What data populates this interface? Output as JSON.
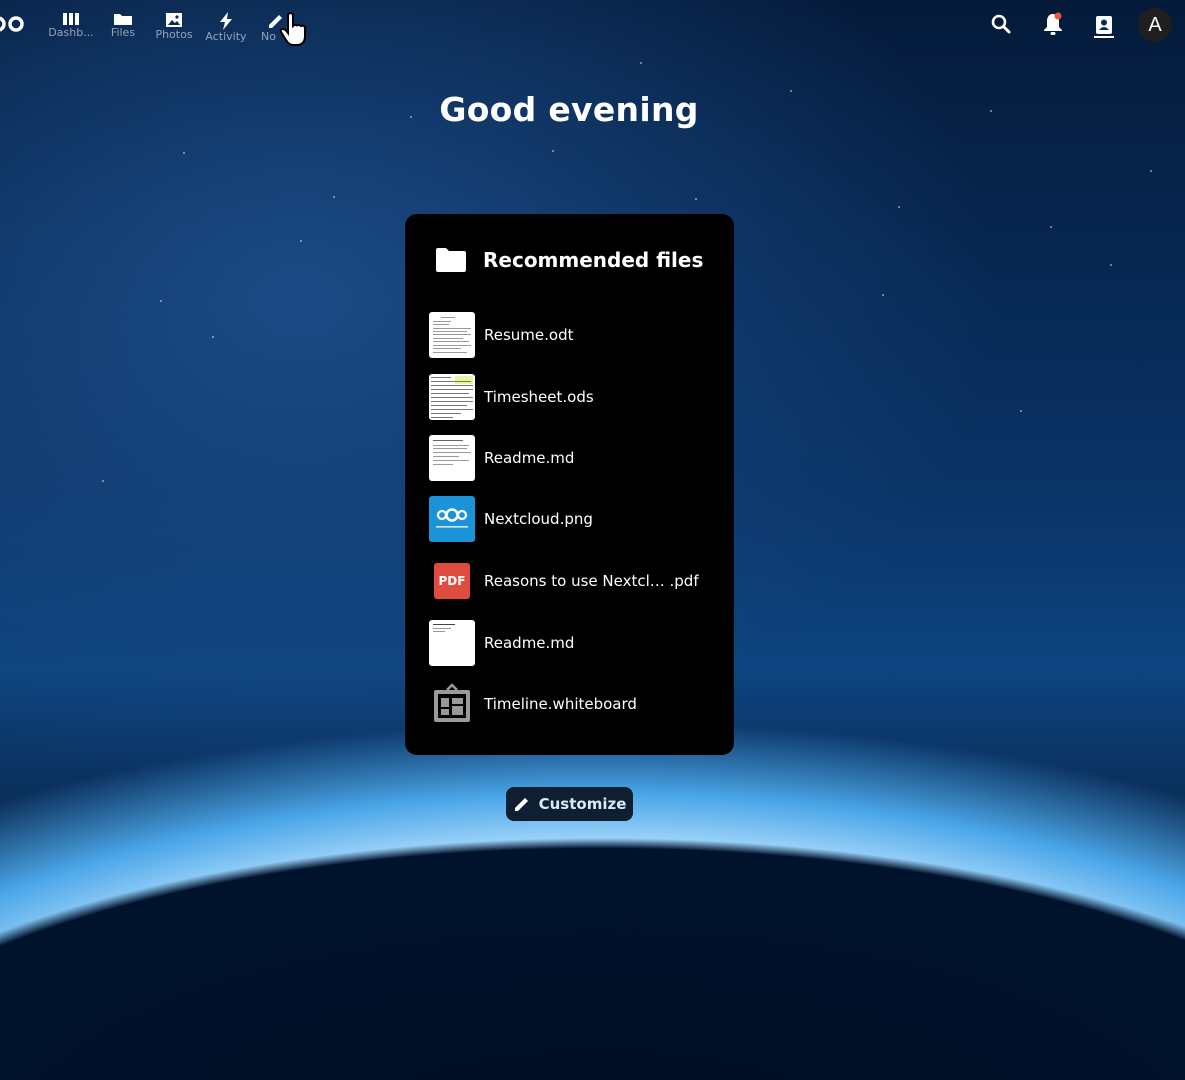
{
  "header": {
    "apps": [
      {
        "label": "Dashb...",
        "icon": "dashboard-icon"
      },
      {
        "label": "Files",
        "icon": "folder-icon"
      },
      {
        "label": "Photos",
        "icon": "image-icon"
      },
      {
        "label": "Activity",
        "icon": "lightning-icon"
      },
      {
        "label": "No",
        "icon": "pencil-icon"
      }
    ],
    "avatar_letter": "A"
  },
  "greeting": "Good evening",
  "widget": {
    "title": "Recommended files",
    "files": [
      {
        "name": "Resume.odt",
        "thumb": "document"
      },
      {
        "name": "Timesheet.ods",
        "thumb": "spreadsheet"
      },
      {
        "name": "Readme.md",
        "thumb": "text"
      },
      {
        "name": "Nextcloud.png",
        "thumb": "nextcloud-logo"
      },
      {
        "name": "Reasons to use Nextcl… .pdf",
        "thumb": "pdf",
        "pdf_label": "PDF"
      },
      {
        "name": "Readme.md",
        "thumb": "text"
      },
      {
        "name": "Timeline.whiteboard",
        "thumb": "whiteboard"
      }
    ]
  },
  "customize_label": "Customize",
  "colors": {
    "pdf": "#e04c3f",
    "nextcloud_blue": "#1a93d8",
    "notification_dot": "#e8573f"
  }
}
